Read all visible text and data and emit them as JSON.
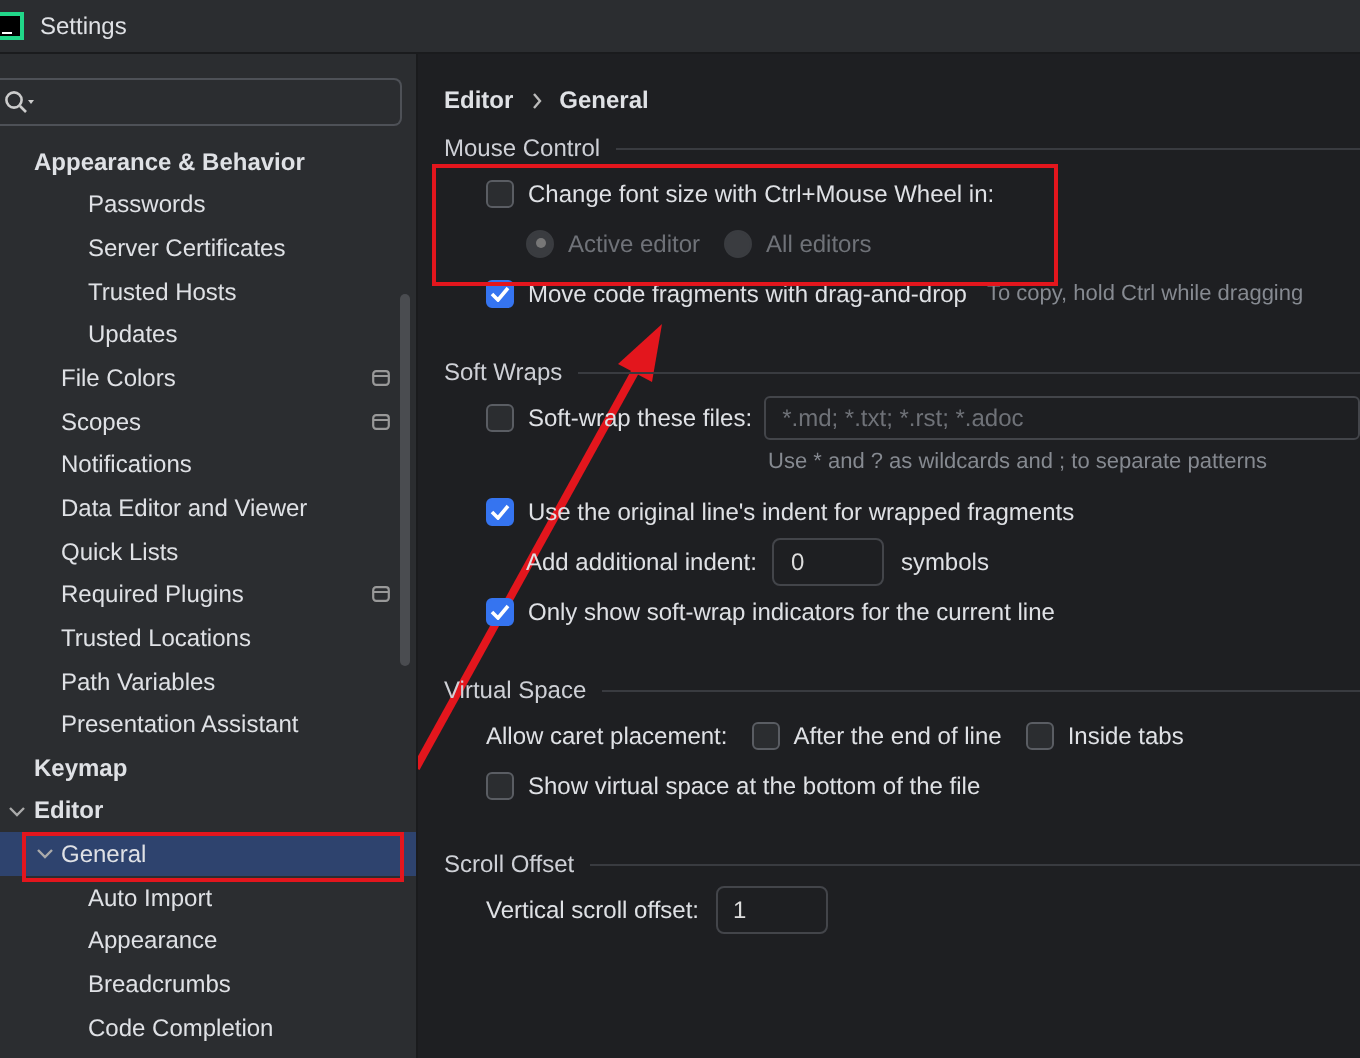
{
  "window": {
    "title": "Settings"
  },
  "sidebar": {
    "items": [
      {
        "label": "Appearance & Behavior",
        "bold": true,
        "selected": false,
        "children": [
          {
            "children": [
              {
                "label": "Passwords",
                "selected": false
              },
              {
                "label": "Server Certificates",
                "selected": false
              },
              {
                "label": "Trusted Hosts",
                "selected": false
              },
              {
                "label": "Updates",
                "selected": false
              }
            ]
          },
          {
            "label": "File Colors",
            "selected": false,
            "has_badge": true
          },
          {
            "label": "Scopes",
            "selected": false,
            "has_badge": true
          },
          {
            "label": "Notifications",
            "selected": false
          },
          {
            "label": "Data Editor and Viewer",
            "selected": false
          },
          {
            "label": "Quick Lists",
            "selected": false
          },
          {
            "label": "Required Plugins",
            "selected": false,
            "has_badge": true
          },
          {
            "label": "Trusted Locations",
            "selected": false
          },
          {
            "label": "Path Variables",
            "selected": false
          },
          {
            "label": "Presentation Assistant",
            "selected": false
          }
        ]
      },
      {
        "label": "Keymap",
        "bold": true,
        "selected": false
      },
      {
        "label": "Editor",
        "bold": true,
        "expanded": true,
        "selected": false,
        "children": [
          {
            "label": "General",
            "expanded": true,
            "selected": true,
            "children": [
              {
                "label": "Auto Import",
                "selected": false
              },
              {
                "label": "Appearance",
                "selected": false
              },
              {
                "label": "Breadcrumbs",
                "selected": false
              },
              {
                "label": "Code Completion",
                "selected": false
              }
            ]
          }
        ]
      }
    ]
  },
  "breadcrumb": [
    "Editor",
    "General"
  ],
  "sections": [
    {
      "title": "Mouse Control",
      "rows": [
        {
          "kind": "checkbox",
          "label": "Change font size with Ctrl+Mouse Wheel in:",
          "checked": false
        },
        {
          "kind": "radios",
          "options": [
            {
              "label": "Active editor",
              "selected": true,
              "disabled": true
            },
            {
              "label": "All editors",
              "selected": false,
              "disabled": true
            }
          ]
        },
        {
          "kind": "checkbox",
          "label": "Move code fragments with drag-and-drop",
          "checked": true,
          "hint": "To copy, hold Ctrl while dragging"
        }
      ]
    },
    {
      "title": "Soft Wraps",
      "rows": [
        {
          "kind": "checkfield",
          "label": "Soft-wrap these files:",
          "checked": false,
          "placeholder": "*.md; *.txt; *.rst; *.adoc",
          "note": "Use * and ? as wildcards and ; to separate patterns"
        },
        {
          "kind": "checkbox",
          "label": "Use the original line's indent for wrapped fragments",
          "checked": true
        },
        {
          "kind": "number",
          "label": "Add additional indent:",
          "value": "0",
          "suffix": "symbols",
          "indented": true
        },
        {
          "kind": "checkbox",
          "label": "Only show soft-wrap indicators for the current line",
          "checked": true
        }
      ]
    },
    {
      "title": "Virtual Space",
      "rows": [
        {
          "kind": "checkgroup",
          "label": "Allow caret placement:",
          "options": [
            {
              "label": "After the end of line",
              "checked": false
            },
            {
              "label": "Inside tabs",
              "checked": false
            }
          ]
        },
        {
          "kind": "checkbox",
          "label": "Show virtual space at the bottom of the file",
          "checked": false
        }
      ]
    },
    {
      "title": "Scroll Offset",
      "rows": [
        {
          "kind": "number",
          "label": "Vertical scroll offset:",
          "value": "1",
          "indented": false
        }
      ]
    }
  ]
}
